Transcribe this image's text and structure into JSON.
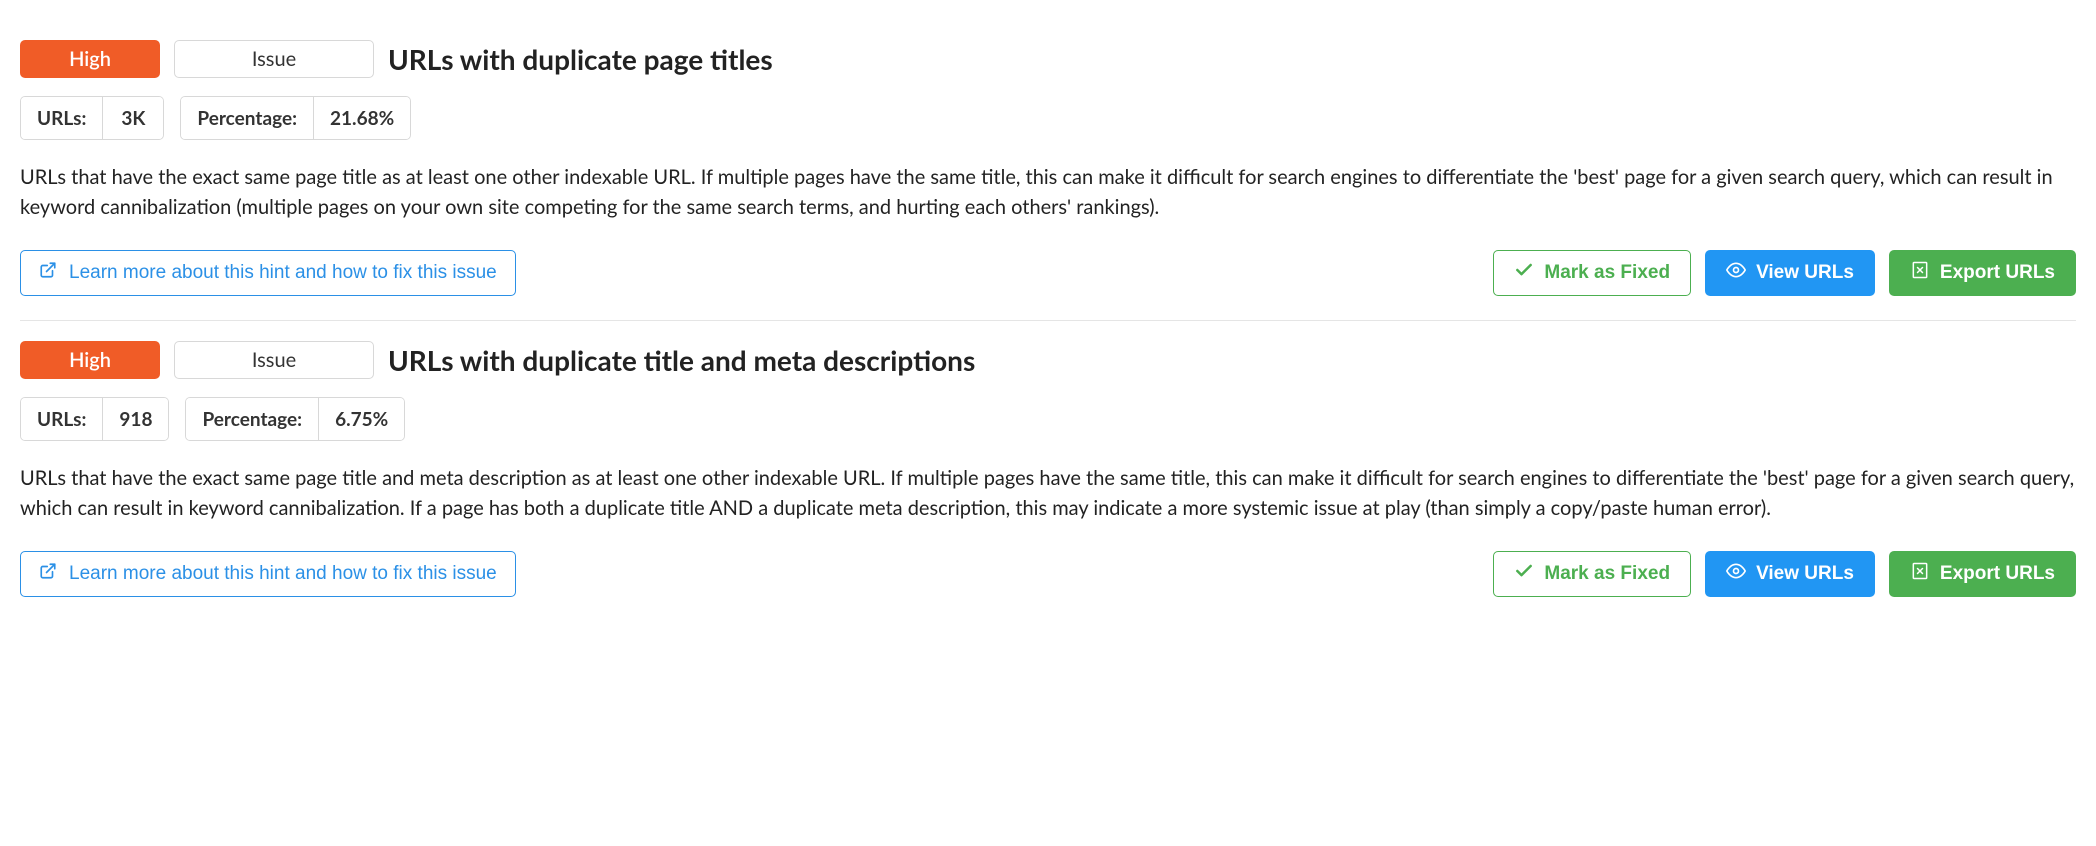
{
  "labels": {
    "urls": "URLs:",
    "percentage": "Percentage:",
    "learn_more": "Learn more about this hint and how to fix this issue",
    "mark_fixed": "Mark as Fixed",
    "view_urls": "View URLs",
    "export_urls": "Export URLs"
  },
  "issues": [
    {
      "severity": "High",
      "type": "Issue",
      "title": "URLs with duplicate page titles",
      "url_count": "3K",
      "percentage": "21.68%",
      "description": "URLs that have the exact same page title as at least one other indexable URL. If multiple pages have the same title, this can make it difficult for search engines to differentiate the 'best' page for a given search query, which can result in keyword cannibalization (multiple pages on your own site competing for the same search terms, and hurting each others' rankings)."
    },
    {
      "severity": "High",
      "type": "Issue",
      "title": "URLs with duplicate title and meta descriptions",
      "url_count": "918",
      "percentage": "6.75%",
      "description": "URLs that have the exact same page title and meta description as at least one other indexable URL. If multiple pages have the same title, this can make it difficult for search engines to differentiate the 'best' page for a given search query, which can result in keyword cannibalization. If a page has both a duplicate title AND a duplicate meta description, this may indicate a more systemic issue at play (than simply a copy/paste human error)."
    }
  ]
}
